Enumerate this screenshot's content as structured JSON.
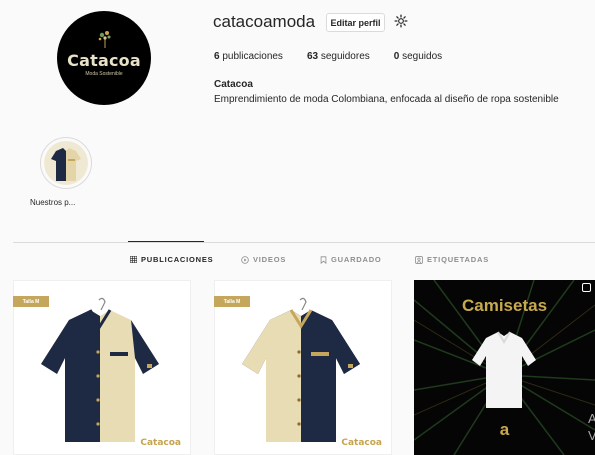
{
  "profile": {
    "username": "catacoamoda",
    "edit_label": "Editar perfil",
    "avatar_brand": "Catacoa",
    "avatar_tagline": "Moda Sostenible",
    "stats": {
      "posts_count": "6",
      "posts_label": " publicaciones",
      "followers_count": "63",
      "followers_label": " seguidores",
      "following_count": "0",
      "following_label": " seguidos"
    },
    "full_name": "Catacoa",
    "bio": "Emprendimiento de moda Colombiana, enfocada al diseño de ropa sostenible"
  },
  "highlights": [
    {
      "label": "Nuestros p..."
    }
  ],
  "tabs": [
    {
      "label": "PUBLICACIONES",
      "icon": "grid-icon",
      "active": true
    },
    {
      "label": "VIDEOS",
      "icon": "play-icon",
      "active": false
    },
    {
      "label": "GUARDADO",
      "icon": "bookmark-icon",
      "active": false
    },
    {
      "label": "ETIQUETADAS",
      "icon": "tag-icon",
      "active": false
    }
  ],
  "posts": [
    {
      "size_tag": "Talla M",
      "brand": "Catacoa"
    },
    {
      "size_tag": "Talla M",
      "brand": "Catacoa"
    },
    {
      "title": "Camisetas",
      "letter": "a",
      "side_text": "A\nV"
    }
  ],
  "colors": {
    "gold": "#c4a75c",
    "navy": "#1e2a44",
    "cream": "#e8dcb5"
  }
}
